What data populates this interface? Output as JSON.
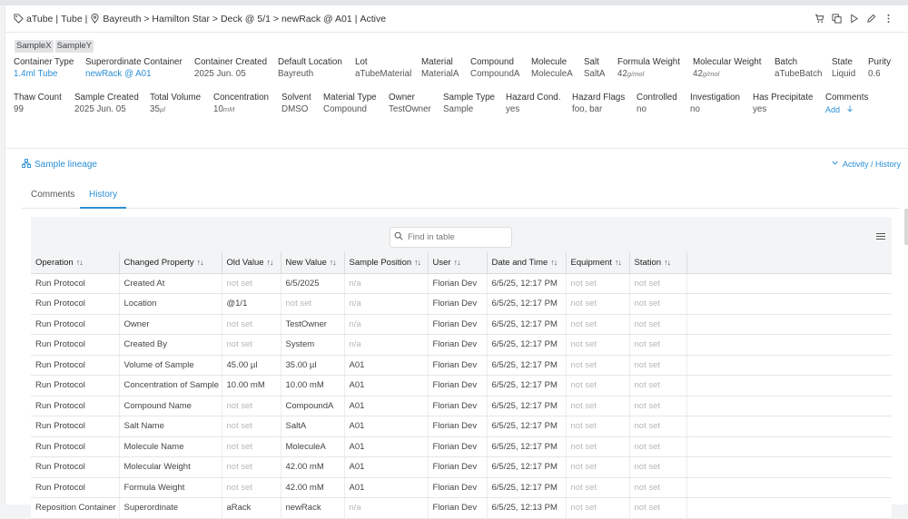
{
  "header": {
    "tag_icon": "tag-icon",
    "name": "aTube",
    "type": "Tube",
    "location_icon": "map-pin-icon",
    "path": "Bayreuth > Hamilton Star > Deck @ 5/1 > newRack @ A01",
    "status": "Active",
    "separator": "|",
    "actions": [
      "cart-icon",
      "copy-icon",
      "play-icon",
      "edit-pencil-icon",
      "more-vertical-icon"
    ]
  },
  "tags": [
    "SampleX",
    "SampleY"
  ],
  "properties_row1": [
    {
      "label": "Container Type",
      "value": "1.4ml Tube",
      "link": true
    },
    {
      "label": "Superordinate Container",
      "value": "newRack @ A01",
      "link": true
    },
    {
      "label": "Container Created",
      "value": "2025 Jun. 05"
    },
    {
      "label": "Default Location",
      "value": "Bayreuth"
    },
    {
      "label": "Lot",
      "value": "aTubeMaterial"
    },
    {
      "label": "Material",
      "value": "MaterialA"
    },
    {
      "label": "Compound",
      "value": "CompoundA"
    },
    {
      "label": "Molecule",
      "value": "MoleculeA"
    },
    {
      "label": "Salt",
      "value": "SaltA"
    },
    {
      "label": "Formula Weight",
      "value": "42",
      "unit": "g/mol"
    },
    {
      "label": "Molecular Weight",
      "value": "42",
      "unit": "g/mol"
    },
    {
      "label": "Batch",
      "value": "aTubeBatch"
    },
    {
      "label": "State",
      "value": "Liquid"
    },
    {
      "label": "Purity",
      "value": "0.6"
    }
  ],
  "properties_row2": [
    {
      "label": "Thaw Count",
      "value": "99"
    },
    {
      "label": "Sample Created",
      "value": "2025 Jun. 05"
    },
    {
      "label": "Total Volume",
      "value": "35",
      "unit": "µl"
    },
    {
      "label": "Concentration",
      "value": "10",
      "unit": "mM"
    },
    {
      "label": "Solvent",
      "value": "DMSO"
    },
    {
      "label": "Material Type",
      "value": "Compound"
    },
    {
      "label": "Owner",
      "value": "TestOwner"
    },
    {
      "label": "Sample Type",
      "value": "Sample"
    },
    {
      "label": "Hazard Cond.",
      "value": "yes"
    },
    {
      "label": "Hazard Flags",
      "value": "foo, bar"
    },
    {
      "label": "Controlled",
      "value": "no"
    },
    {
      "label": "Investigation",
      "value": "no"
    },
    {
      "label": "Has Precipitate",
      "value": "yes"
    },
    {
      "label": "Comments",
      "value": "Add",
      "link": true
    }
  ],
  "lineage": {
    "label": "Sample lineage",
    "icon": "hierarchy-icon"
  },
  "activity": {
    "label": "Activity / History",
    "icon": "chevron-down-icon"
  },
  "tabs": [
    {
      "label": "Comments",
      "active": false
    },
    {
      "label": "History",
      "active": true
    }
  ],
  "search": {
    "placeholder": "Find in table",
    "value": "",
    "icon": "search-icon"
  },
  "table": {
    "columns": [
      "Operation",
      "Changed Property",
      "Old Value",
      "New Value",
      "Sample Position",
      "User",
      "Date and Time",
      "Equipment",
      "Station"
    ],
    "sort_icon": "sort-icon",
    "rows": [
      [
        "Run Protocol",
        "Created At",
        "not set",
        "6/5/2025",
        "n/a",
        "Florian Dev",
        "6/5/25, 12:17 PM",
        "not set",
        "not set"
      ],
      [
        "Run Protocol",
        "Location",
        "@1/1",
        "not set",
        "n/a",
        "Florian Dev",
        "6/5/25, 12:17 PM",
        "not set",
        "not set"
      ],
      [
        "Run Protocol",
        "Owner",
        "not set",
        "TestOwner",
        "n/a",
        "Florian Dev",
        "6/5/25, 12:17 PM",
        "not set",
        "not set"
      ],
      [
        "Run Protocol",
        "Created By",
        "not set",
        "System",
        "n/a",
        "Florian Dev",
        "6/5/25, 12:17 PM",
        "not set",
        "not set"
      ],
      [
        "Run Protocol",
        "Volume of Sample",
        "45.00 µl",
        "35.00 µl",
        "A01",
        "Florian Dev",
        "6/5/25, 12:17 PM",
        "not set",
        "not set"
      ],
      [
        "Run Protocol",
        "Concentration of Sample",
        "10.00 mM",
        "10.00 mM",
        "A01",
        "Florian Dev",
        "6/5/25, 12:17 PM",
        "not set",
        "not set"
      ],
      [
        "Run Protocol",
        "Compound Name",
        "not set",
        "CompoundA",
        "A01",
        "Florian Dev",
        "6/5/25, 12:17 PM",
        "not set",
        "not set"
      ],
      [
        "Run Protocol",
        "Salt Name",
        "not set",
        "SaltA",
        "A01",
        "Florian Dev",
        "6/5/25, 12:17 PM",
        "not set",
        "not set"
      ],
      [
        "Run Protocol",
        "Molecule Name",
        "not set",
        "MoleculeA",
        "A01",
        "Florian Dev",
        "6/5/25, 12:17 PM",
        "not set",
        "not set"
      ],
      [
        "Run Protocol",
        "Molecular Weight",
        "not set",
        "42.00 mM",
        "A01",
        "Florian Dev",
        "6/5/25, 12:17 PM",
        "not set",
        "not set"
      ],
      [
        "Run Protocol",
        "Formula Weight",
        "not set",
        "42.00 mM",
        "A01",
        "Florian Dev",
        "6/5/25, 12:17 PM",
        "not set",
        "not set"
      ],
      [
        "Reposition Container",
        "Superordinate",
        "aRack",
        "newRack",
        "n/a",
        "Florian Dev",
        "6/5/25, 12:13 PM",
        "not set",
        "not set"
      ]
    ]
  },
  "colors": {
    "link": "#2b8fd6",
    "muted_text": "#b7b7b7",
    "tag_bg": "#e2e3e5"
  }
}
